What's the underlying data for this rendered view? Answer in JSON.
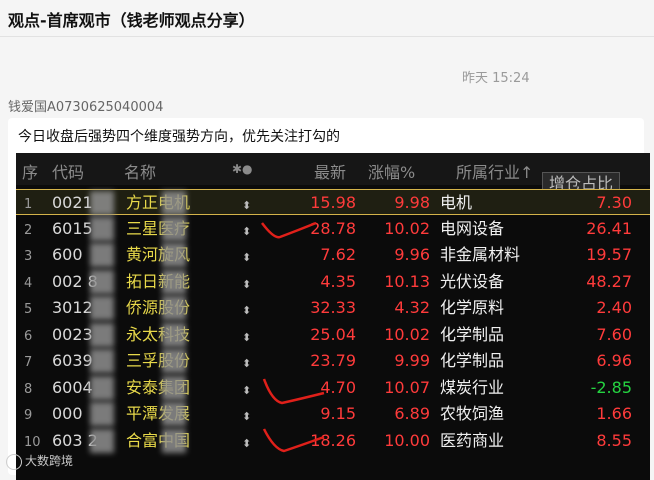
{
  "chat": {
    "title": "观点-首席观市（钱老师观点分享）",
    "timestamp": "昨天 15:24",
    "sender": "钱爱国A0730625040004",
    "message": "今日收盘后强势四个维度强势方向，优先关注打勾的"
  },
  "table": {
    "headers": {
      "seq": "序",
      "code": "代码",
      "name": "名称",
      "mark": "✱●",
      "price": "最新",
      "change": "涨幅%",
      "industry": "所属行业↑",
      "ratio": "增仓占比"
    },
    "rows": [
      {
        "seq": "1",
        "code": "0021",
        "name": "方正电机",
        "mark": "⬍",
        "price": "15.98",
        "change": "9.98",
        "industry": "电机",
        "ratio": "7.30",
        "ratio_color": "#ff3b3b"
      },
      {
        "seq": "2",
        "code": "6015",
        "name": "三星医疗",
        "mark": "⬍",
        "price": "28.78",
        "change": "10.02",
        "industry": "电网设备",
        "ratio": "26.41",
        "ratio_color": "#ff3b3b"
      },
      {
        "seq": "3",
        "code": "600",
        "name": "黄河旋风",
        "mark": "⬍",
        "price": "7.62",
        "change": "9.96",
        "industry": "非金属材料",
        "ratio": "19.57",
        "ratio_color": "#ff3b3b"
      },
      {
        "seq": "4",
        "code": "002 8",
        "name": "拓日新能",
        "mark": "⬍",
        "price": "4.35",
        "change": "10.13",
        "industry": "光伏设备",
        "ratio": "48.27",
        "ratio_color": "#ff3b3b"
      },
      {
        "seq": "5",
        "code": "3012",
        "name": "侨源股份",
        "mark": "⬍",
        "price": "32.33",
        "change": "4.32",
        "industry": "化学原料",
        "ratio": "2.40",
        "ratio_color": "#ff3b3b"
      },
      {
        "seq": "6",
        "code": "0023",
        "name": "永太科技",
        "mark": "⬍",
        "price": "25.04",
        "change": "10.02",
        "industry": "化学制品",
        "ratio": "7.60",
        "ratio_color": "#ff3b3b"
      },
      {
        "seq": "7",
        "code": "6039",
        "name": "三孚股份",
        "mark": "⬍",
        "price": "23.79",
        "change": "9.99",
        "industry": "化学制品",
        "ratio": "6.96",
        "ratio_color": "#ff3b3b"
      },
      {
        "seq": "8",
        "code": "6004",
        "name": "安泰集团",
        "mark": "⬍",
        "price": "4.70",
        "change": "10.07",
        "industry": "煤炭行业",
        "ratio": "-2.85",
        "ratio_color": "#25d441"
      },
      {
        "seq": "9",
        "code": "000",
        "name": "平潭发展",
        "mark": "⬍",
        "price": "9.15",
        "change": "6.89",
        "industry": "农牧饲渔",
        "ratio": "1.66",
        "ratio_color": "#ff3b3b"
      },
      {
        "seq": "10",
        "code": "603 2",
        "name": "合富中国",
        "mark": "⬍",
        "price": "18.26",
        "change": "10.00",
        "industry": "医药商业",
        "ratio": "8.55",
        "ratio_color": "#ff3b3b"
      }
    ]
  },
  "watermark": "大数跨境"
}
